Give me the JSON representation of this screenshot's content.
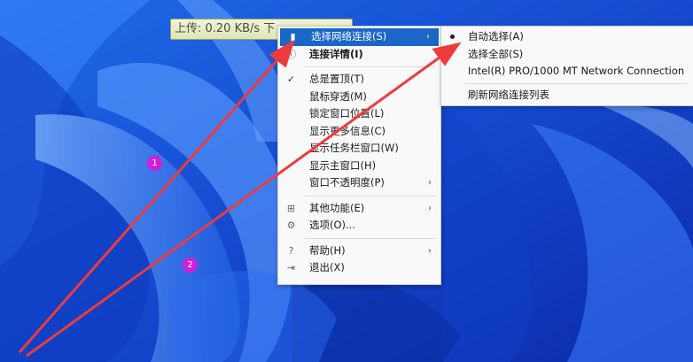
{
  "speed_bar": {
    "text": "上传: 0.20 KB/s   下"
  },
  "main_menu": {
    "items": [
      {
        "label": "选择网络连接(S)",
        "icon": "network-icon",
        "highlighted": true,
        "submenu": true
      },
      {
        "label": "连接详情(I)",
        "icon": "info-icon",
        "bold": true
      },
      {
        "separator": true
      },
      {
        "label": "总是置顶(T)",
        "icon": "check-icon",
        "checked": true
      },
      {
        "label": "鼠标穿透(M)"
      },
      {
        "label": "锁定窗口位置(L)"
      },
      {
        "label": "显示更多信息(C)"
      },
      {
        "label": "显示任务栏窗口(W)"
      },
      {
        "label": "显示主窗口(H)"
      },
      {
        "label": "窗口不透明度(P)",
        "submenu": true
      },
      {
        "separator": true
      },
      {
        "label": "其他功能(E)",
        "icon": "grid-icon",
        "submenu": true
      },
      {
        "label": "选项(O)...",
        "icon": "gear-icon"
      },
      {
        "separator": true
      },
      {
        "label": "帮助(H)",
        "icon": "help-icon",
        "submenu": true
      },
      {
        "label": "退出(X)",
        "icon": "exit-icon"
      }
    ]
  },
  "sub_menu": {
    "items": [
      {
        "label": "自动选择(A)",
        "selected": true
      },
      {
        "label": "选择全部(S)"
      },
      {
        "label": "Intel(R) PRO/1000 MT Network Connection"
      },
      {
        "separator": true
      },
      {
        "label": "刷新网络连接列表"
      }
    ]
  },
  "annotations": {
    "badge_1": "1",
    "badge_2": "2"
  },
  "colors": {
    "highlight": "#1a66c9",
    "arrow": "#ee3b3b",
    "badge": "#d01fd8"
  }
}
